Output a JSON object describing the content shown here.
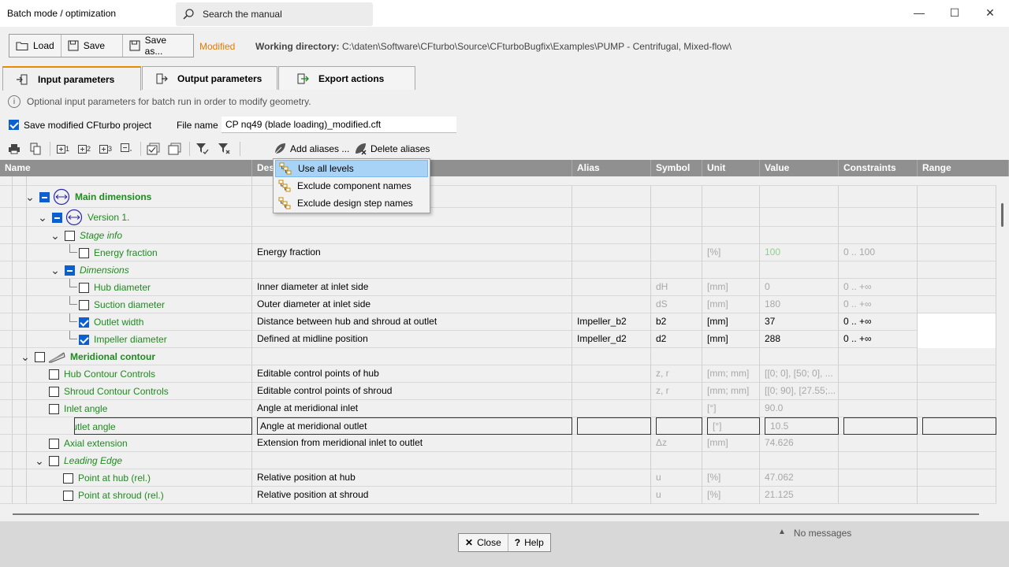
{
  "window": {
    "title": "Batch mode / optimization",
    "search_placeholder": "Search the manual",
    "controls": {
      "minimize": "—",
      "maximize": "☐",
      "close": "✕"
    }
  },
  "toolbar": {
    "load": "Load",
    "save": "Save",
    "save_as": "Save as...",
    "modified": "Modified",
    "working_dir_label": "Working directory:",
    "working_dir_value": "C:\\daten\\Software\\CFturbo\\Source\\CFturboBugfix\\Examples\\PUMP - Centrifugal, Mixed-flow\\"
  },
  "tabs": [
    {
      "label": "Input parameters",
      "active": true
    },
    {
      "label": "Output parameters",
      "active": false
    },
    {
      "label": "Export actions",
      "active": false
    }
  ],
  "info": "Optional input parameters for batch run in order to modify geometry.",
  "save_project": {
    "label": "Save modified CFturbo project",
    "checked": true,
    "file_name_label": "File name",
    "file_name_value": "CP nq49 (blade loading)_modified.cft"
  },
  "actions": {
    "add_aliases": "Add aliases ...",
    "delete_aliases": "Delete aliases",
    "level1": "1",
    "level2": "2",
    "level3": "3"
  },
  "alias_menu": [
    {
      "label": "Use all levels",
      "selected": true
    },
    {
      "label": "Exclude component names",
      "selected": false
    },
    {
      "label": "Exclude design step names",
      "selected": false
    }
  ],
  "columns": [
    "Name",
    "Des",
    "Alias",
    "Symbol",
    "Unit",
    "Value",
    "Constraints",
    "Range"
  ],
  "rows": [
    {
      "name": "Main dimensions",
      "desc": "",
      "alias": "",
      "symbol": "",
      "unit": "",
      "value": "",
      "constraints": ""
    },
    {
      "name": "Version 1.",
      "desc": "",
      "alias": "",
      "symbol": "",
      "unit": "",
      "value": "",
      "constraints": ""
    },
    {
      "name": "Stage info",
      "desc": "",
      "alias": "",
      "symbol": "",
      "unit": "",
      "value": "",
      "constraints": ""
    },
    {
      "name": "Energy fraction",
      "desc": "Energy fraction",
      "alias": "",
      "symbol": "",
      "unit": "[%]",
      "value": "100",
      "constraints": "0 .. 100"
    },
    {
      "name": "Dimensions",
      "desc": "",
      "alias": "",
      "symbol": "",
      "unit": "",
      "value": "",
      "constraints": ""
    },
    {
      "name": "Hub diameter",
      "desc": "Inner diameter at inlet side",
      "alias": "",
      "symbol": "dH",
      "unit": "[mm]",
      "value": "0",
      "constraints": "0 .. +∞"
    },
    {
      "name": "Suction diameter",
      "desc": "Outer diameter at inlet side",
      "alias": "",
      "symbol": "dS",
      "unit": "[mm]",
      "value": "180",
      "constraints": "0 .. +∞"
    },
    {
      "name": "Outlet width",
      "desc": "Distance between hub and shroud at outlet",
      "alias": "Impeller_b2",
      "symbol": "b2",
      "unit": "[mm]",
      "value": "37",
      "constraints": "0 .. +∞"
    },
    {
      "name": "Impeller diameter",
      "desc": "Defined at midline position",
      "alias": "Impeller_d2",
      "symbol": "d2",
      "unit": "[mm]",
      "value": "288",
      "constraints": "0 .. +∞"
    },
    {
      "name": "Meridional contour",
      "desc": "",
      "alias": "",
      "symbol": "",
      "unit": "",
      "value": "",
      "constraints": ""
    },
    {
      "name": "Hub Contour Controls",
      "desc": "Editable control points of hub",
      "alias": "",
      "symbol": "z, r",
      "unit": "[mm; mm]",
      "value": "[[0; 0], [50; 0], ...",
      "constraints": ""
    },
    {
      "name": "Shroud Contour Controls",
      "desc": "Editable control points of shroud",
      "alias": "",
      "symbol": "z, r",
      "unit": "[mm; mm]",
      "value": "[[0; 90], [27.55;...",
      "constraints": ""
    },
    {
      "name": "Inlet angle",
      "desc": "Angle at meridional inlet",
      "alias": "",
      "symbol": "",
      "unit": "[°]",
      "value": "90.0",
      "constraints": ""
    },
    {
      "name": "Outlet angle",
      "desc": "Angle at meridional outlet",
      "alias": "",
      "symbol": "",
      "unit": "[°]",
      "value": "10.5",
      "constraints": ""
    },
    {
      "name": "Axial extension",
      "desc": "Extension from meridional inlet to outlet",
      "alias": "",
      "symbol": "Δz",
      "unit": "[mm]",
      "value": "74.626",
      "constraints": ""
    },
    {
      "name": "Leading Edge",
      "desc": "",
      "alias": "",
      "symbol": "",
      "unit": "",
      "value": "",
      "constraints": ""
    },
    {
      "name": "Point at hub (rel.)",
      "desc": "Relative position at hub",
      "alias": "",
      "symbol": "u",
      "unit": "[%]",
      "value": "47.062",
      "constraints": ""
    },
    {
      "name": "Point at shroud (rel.)",
      "desc": "Relative position at shroud",
      "alias": "",
      "symbol": "u",
      "unit": "[%]",
      "value": "21.125",
      "constraints": ""
    }
  ],
  "footer": {
    "close": "Close",
    "help": "Help",
    "messages": "No messages"
  }
}
